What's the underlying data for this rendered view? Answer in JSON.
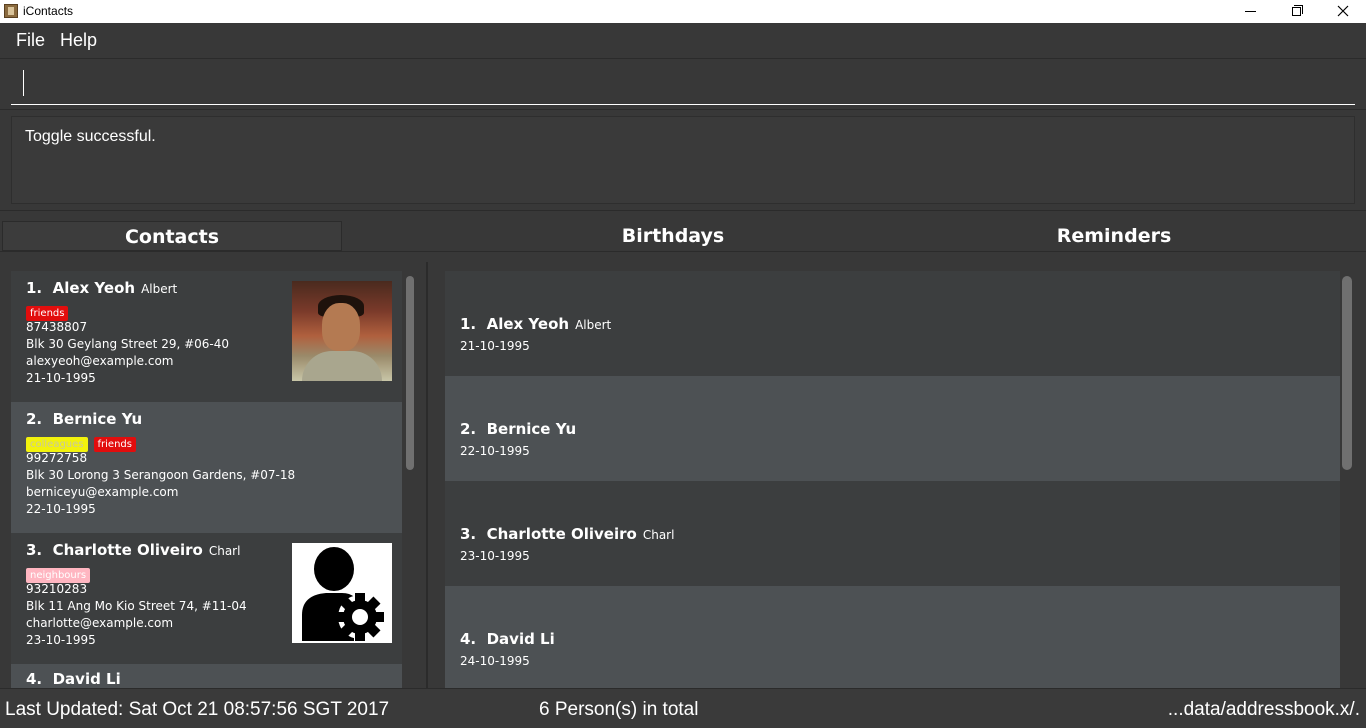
{
  "window": {
    "title": "iContacts"
  },
  "menu": {
    "file": "File",
    "help": "Help"
  },
  "command": {
    "value": "",
    "placeholder": ""
  },
  "result": {
    "text": "Toggle successful."
  },
  "tabs": {
    "contacts": "Contacts",
    "birthdays": "Birthdays",
    "reminders": "Reminders"
  },
  "contacts": [
    {
      "index": "1.",
      "name": "Alex Yeoh",
      "alias": "Albert",
      "tags": [
        {
          "label": "friends",
          "color": "#e20d0d"
        }
      ],
      "phone": "87438807",
      "address": "Blk 30 Geylang Street 29, #06-40",
      "email": "alexyeoh@example.com",
      "birthday": "21-10-1995",
      "photo": "person-photo"
    },
    {
      "index": "2.",
      "name": "Bernice Yu",
      "alias": "",
      "tags": [
        {
          "label": "colleagues",
          "color": "#f2f20d"
        },
        {
          "label": "friends",
          "color": "#e20d0d"
        }
      ],
      "phone": "99272758",
      "address": "Blk 30 Lorong 3 Serangoon Gardens, #07-18",
      "email": "berniceyu@example.com",
      "birthday": "22-10-1995",
      "photo": ""
    },
    {
      "index": "3.",
      "name": "Charlotte Oliveiro",
      "alias": "Charl",
      "tags": [
        {
          "label": "neighbours",
          "color": "#ffb6c1"
        }
      ],
      "phone": "93210283",
      "address": "Blk 11 Ang Mo Kio Street 74, #11-04",
      "email": "charlotte@example.com",
      "birthday": "23-10-1995",
      "photo": "user-settings-icon"
    },
    {
      "index": "4.",
      "name": "David Li",
      "alias": ""
    }
  ],
  "birthdays": [
    {
      "index": "1.",
      "name": "Alex Yeoh",
      "alias": "Albert",
      "date": "21-10-1995"
    },
    {
      "index": "2.",
      "name": "Bernice Yu",
      "alias": "",
      "date": "22-10-1995"
    },
    {
      "index": "3.",
      "name": "Charlotte Oliveiro",
      "alias": "Charl",
      "date": "23-10-1995"
    },
    {
      "index": "4.",
      "name": "David Li",
      "alias": "",
      "date": "24-10-1995"
    }
  ],
  "status": {
    "last_updated": "Last Updated: Sat Oct 21 08:57:56 SGT 2017",
    "total": "6 Person(s) in total",
    "path": "...data/addressbook.x/."
  }
}
